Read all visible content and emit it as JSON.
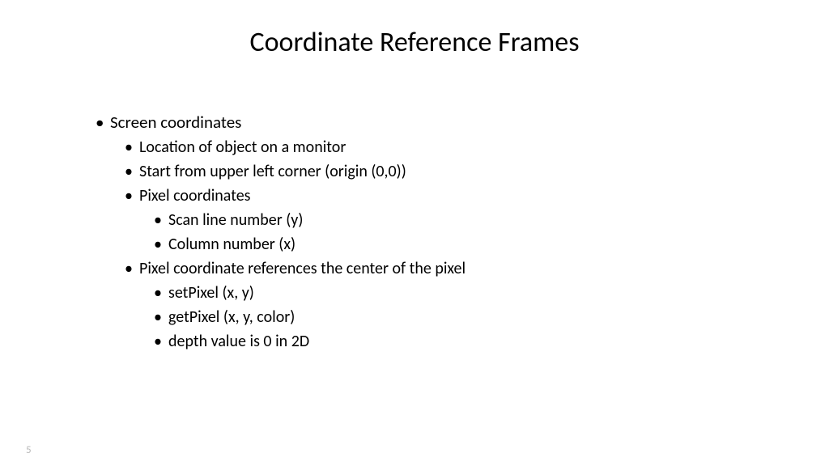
{
  "slide": {
    "title": "Coordinate Reference Frames",
    "pageNumber": "5",
    "bullets": {
      "b1": "Screen coordinates",
      "b1_1": "Location of object on a monitor",
      "b1_2": "Start from upper left corner (origin (0,0))",
      "b1_3": "Pixel coordinates",
      "b1_3_1": "Scan line number (y)",
      "b1_3_2": "Column number (x)",
      "b1_4": "Pixel coordinate references the center of the pixel",
      "b1_4_1": "setPixel (x, y)",
      "b1_4_2": "getPixel (x, y, color)",
      "b1_4_3": "depth value is 0 in 2D"
    }
  }
}
